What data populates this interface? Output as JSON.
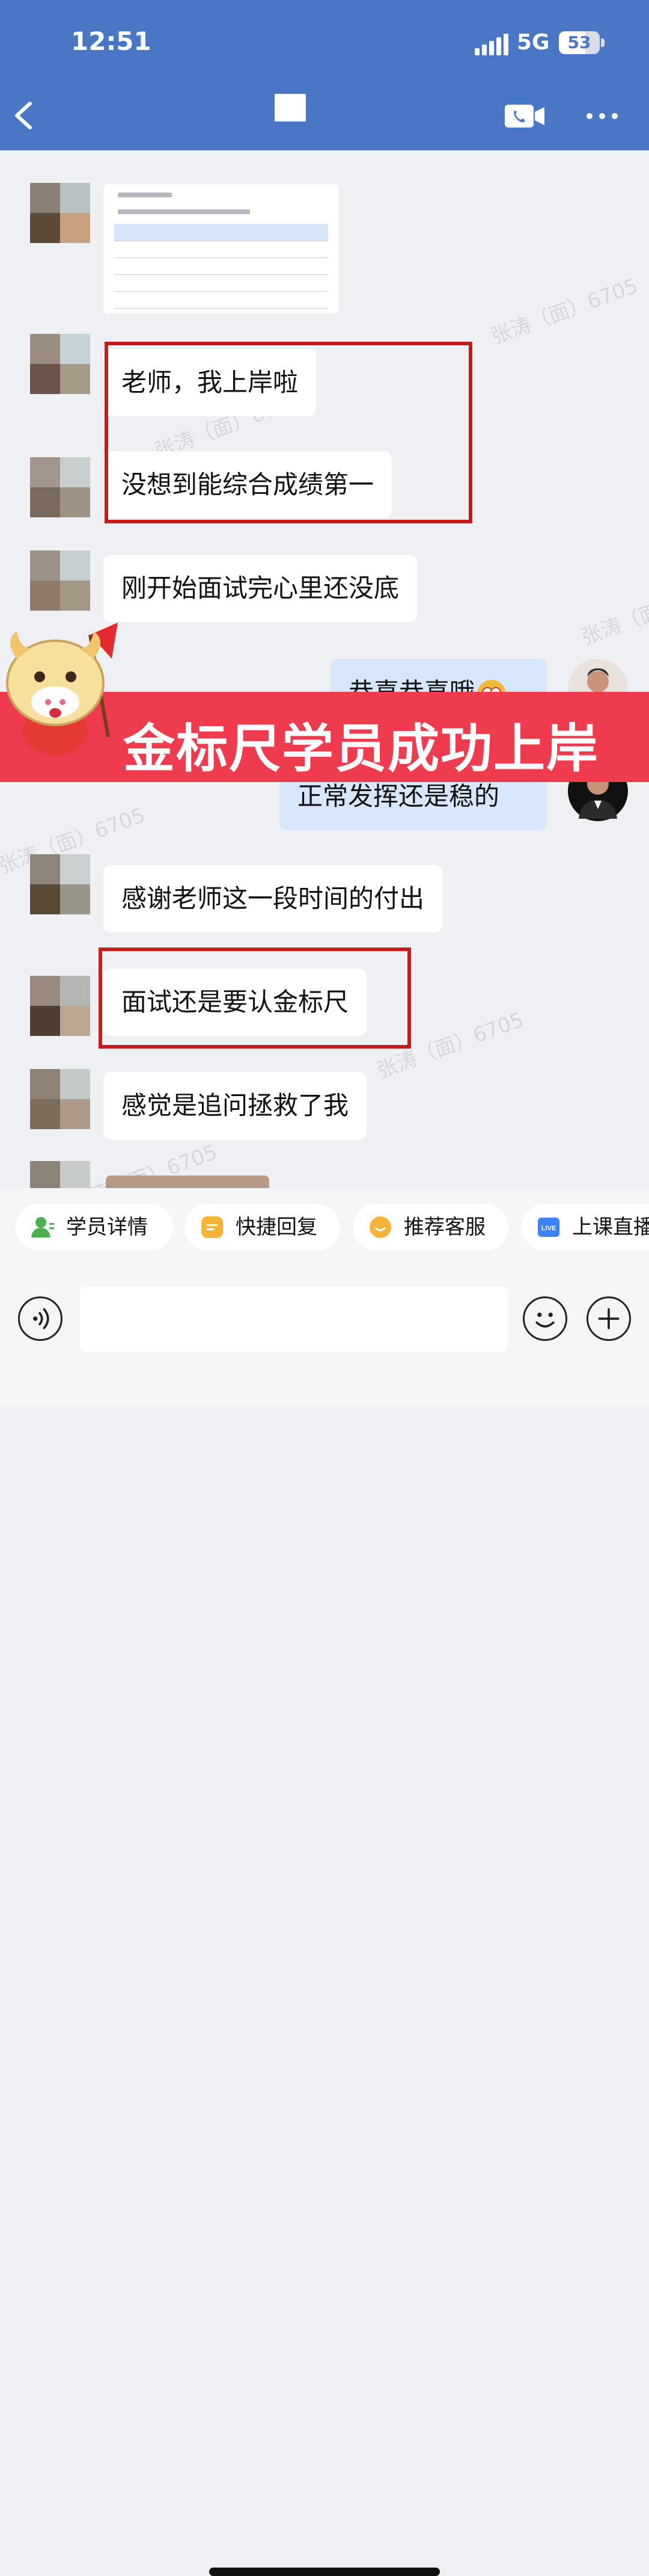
{
  "status_bar": {
    "time": "12:51",
    "network": "5G",
    "battery": "53"
  },
  "header": {
    "back_icon": "chevron-left-icon",
    "video_icon": "video-call-icon",
    "more_icon": "more-dots-icon"
  },
  "messages": [
    {
      "from": "student",
      "type": "image",
      "content": "document-screenshot"
    },
    {
      "from": "student",
      "text": "老师，我上岸啦"
    },
    {
      "from": "student",
      "text": "没想到能综合成绩第一"
    },
    {
      "from": "student",
      "text": "刚开始面试完心里还没底"
    },
    {
      "from": "teacher",
      "text": "恭喜恭喜哦"
    },
    {
      "from": "teacher",
      "text": "正常发挥还是稳的"
    },
    {
      "from": "student",
      "text": "感谢老师这一段时间的付出"
    },
    {
      "from": "student",
      "text": "面试还是要认金标尺"
    },
    {
      "from": "student",
      "text": "感觉是追问拯救了我"
    }
  ],
  "banner": {
    "text": "金标尺学员成功上岸"
  },
  "watermark": "张涛（面）6705",
  "quick_actions": [
    {
      "label": "学员详情",
      "icon": "student-profile-icon",
      "color": "#4caf50"
    },
    {
      "label": "快捷回复",
      "icon": "quick-reply-icon",
      "color": "#f5b33a"
    },
    {
      "label": "推荐客服",
      "icon": "service-icon",
      "color": "#f5b33a"
    },
    {
      "label": "上课直播",
      "icon": "live-icon",
      "color": "#3b82f6"
    }
  ],
  "input_bar": {
    "voice_icon": "voice-icon",
    "emoji_icon": "emoji-icon",
    "plus_icon": "plus-icon",
    "placeholder": ""
  },
  "colors": {
    "header": "#4a76c6",
    "highlight_box": "#c51b1b",
    "banner": "#ee3b4e",
    "my_bubble": "#d6e6fb"
  }
}
